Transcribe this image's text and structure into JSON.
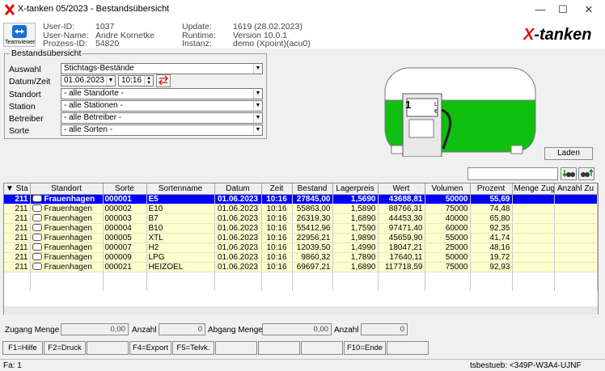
{
  "window": {
    "title": "X-tanken 05/2023 - Bestandsübersicht",
    "minimize": "—",
    "maximize": "☐",
    "close": "✕"
  },
  "header": {
    "teamviewer_label": "Teamviewer",
    "user_id_label": "User-ID:",
    "user_id": "1037",
    "user_name_label": "User-Name:",
    "user_name": "Andre Kornetke",
    "prozess_label": "Prozess-ID:",
    "prozess": "54820",
    "update_label": "Update:",
    "update": "1619 (28.02.2023)",
    "runtime_label": "Runtime:",
    "runtime": "Version 10.0.1",
    "instanz_label": "Instanz:",
    "instanz": "demo (Xpoint)(acu0)",
    "logo": "X-tanken"
  },
  "filters": {
    "group_title": "Bestandsübersicht",
    "auswahl_label": "Auswahl",
    "auswahl": "Stichtags-Bestände",
    "datum_label": "Datum/Zeit",
    "datum": "01.06.2023",
    "zeit": "10:16",
    "standort_label": "Standort",
    "standort": "- alle Standorte -",
    "station_label": "Station",
    "station": "- alle Stationen -",
    "betreiber_label": "Betreiber",
    "betreiber": "- alle Betreiber -",
    "sorte_label": "Sorte",
    "sorte": "- alle Sorten -",
    "laden_button": "Laden",
    "tank_gauge_1": "1",
    "tank_gauge_l": "L",
    "tank_gauge_e": "€"
  },
  "table": {
    "columns": [
      "Sta",
      "Standort",
      "Sorte",
      "Sortenname",
      "Datum",
      "Zeit",
      "Bestand",
      "Lagerpreis",
      "Wert",
      "Volumen",
      "Prozent",
      "Menge Zug",
      "Anzahl Zu"
    ],
    "rows": [
      [
        "211",
        "Frauenhagen",
        "000001",
        "E5",
        "01.06.2023",
        "10:16",
        "27845,00",
        "1,5690",
        "43688,81",
        "50000",
        "55,69",
        "",
        ""
      ],
      [
        "211",
        "Frauenhagen",
        "000002",
        "E10",
        "01.06.2023",
        "10:16",
        "55863,00",
        "1,5890",
        "88766,31",
        "75000",
        "74,48",
        "",
        ""
      ],
      [
        "211",
        "Frauenhagen",
        "000003",
        "B7",
        "01.06.2023",
        "10:16",
        "26319,30",
        "1,6890",
        "44453,30",
        "40000",
        "65,80",
        "",
        ""
      ],
      [
        "211",
        "Frauenhagen",
        "000004",
        "B10",
        "01.06.2023",
        "10:16",
        "55412,96",
        "1,7590",
        "97471,40",
        "60000",
        "92,35",
        "",
        ""
      ],
      [
        "211",
        "Frauenhagen",
        "000005",
        "XTL",
        "01.06.2023",
        "10:16",
        "22956,21",
        "1,9890",
        "45659,90",
        "55000",
        "41,74",
        "",
        ""
      ],
      [
        "211",
        "Frauenhagen",
        "000007",
        "H2",
        "01.06.2023",
        "10:16",
        "12039,50",
        "1,4990",
        "18047,21",
        "25000",
        "48,16",
        "",
        ""
      ],
      [
        "211",
        "Frauenhagen",
        "000009",
        "LPG",
        "01.06.2023",
        "10:16",
        "9860,32",
        "1,7890",
        "17640,11",
        "50000",
        "19,72",
        "",
        ""
      ],
      [
        "211",
        "Frauenhagen",
        "000021",
        "HEIZOEL",
        "01.06.2023",
        "10:16",
        "69697,21",
        "1,6890",
        "117718,59",
        "75000",
        "92,93",
        "",
        ""
      ]
    ]
  },
  "footer": {
    "zugang_menge_label": "Zugang Menge",
    "zugang_menge": "0,00",
    "anzahl1_label": "Anzahl",
    "anzahl1": "0",
    "abgang_menge_label": "Abgang Menge",
    "abgang_menge": "0,00",
    "anzahl2_label": "Anzahl",
    "anzahl2": "0"
  },
  "fkeys": [
    "F1=Hilfe",
    "F2=Druck",
    "",
    "F4=Export",
    "F5=Telvk.",
    "",
    "",
    "",
    "F10=Ende",
    ""
  ],
  "status": {
    "left": "Fa: 1",
    "right": "tsbestueb: <349P-W3A4-UJNF"
  }
}
